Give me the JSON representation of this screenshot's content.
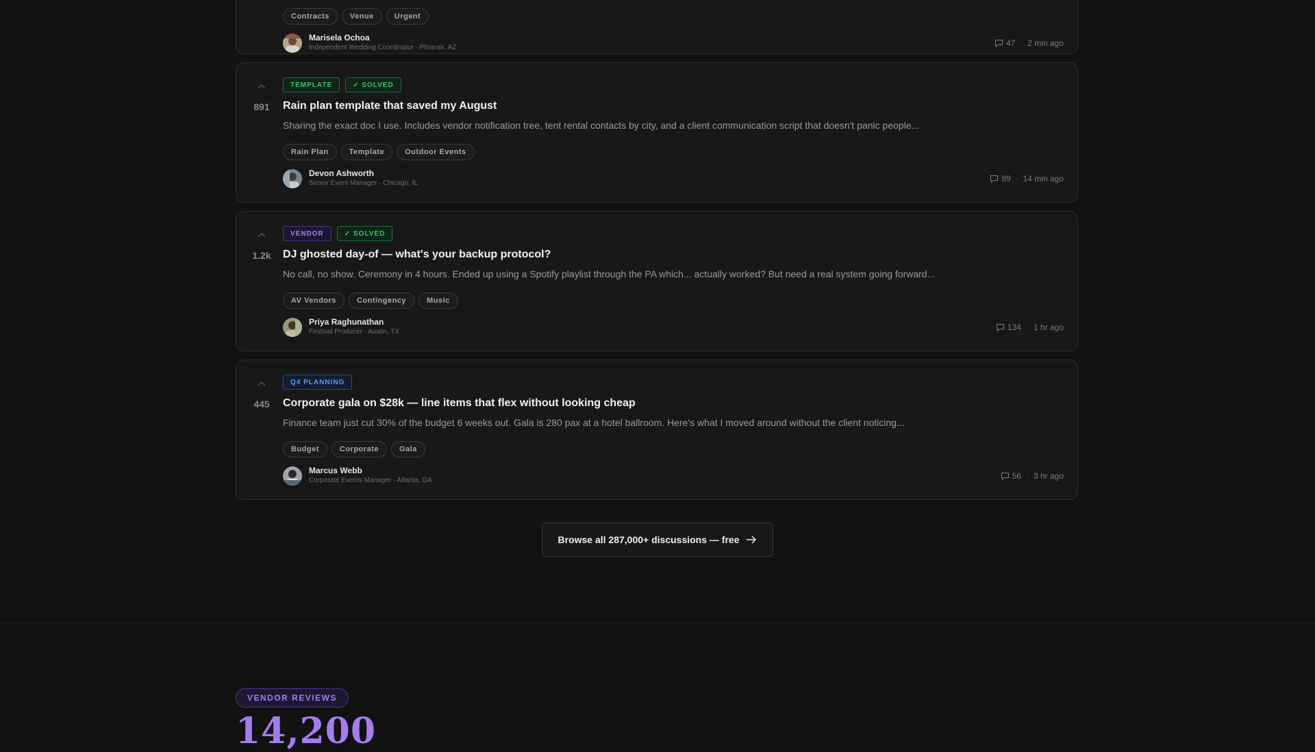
{
  "posts": [
    {
      "tags": [
        "Contracts",
        "Venue",
        "Urgent"
      ],
      "author": {
        "name": "Marisela Ochoa",
        "role": "Independent Wedding Coordinator · Phoenix, AZ"
      },
      "comments": "47",
      "time": "2 min ago"
    },
    {
      "votes": "891",
      "category": "TEMPLATE",
      "solved": "✓ SOLVED",
      "title": "Rain plan template that saved my August",
      "excerpt": "Sharing the exact doc I use. Includes vendor notification tree, tent rental contacts by city, and a client communication script that doesn't panic people...",
      "tags": [
        "Rain Plan",
        "Template",
        "Outdoor Events"
      ],
      "author": {
        "name": "Devon Ashworth",
        "role": "Senior Event Manager · Chicago, IL"
      },
      "comments": "89",
      "time": "14 min ago"
    },
    {
      "votes": "1.2k",
      "category": "VENDOR",
      "solved": "✓ SOLVED",
      "title": "DJ ghosted day-of — what's your backup protocol?",
      "excerpt": "No call, no show. Ceremony in 4 hours. Ended up using a Spotify playlist through the PA which... actually worked? But need a real system going forward...",
      "tags": [
        "AV Vendors",
        "Contingency",
        "Music"
      ],
      "author": {
        "name": "Priya Raghunathan",
        "role": "Festival Producer · Austin, TX"
      },
      "comments": "134",
      "time": "1 hr ago"
    },
    {
      "votes": "445",
      "category": "Q4 PLANNING",
      "title": "Corporate gala on $28k — line items that flex without looking cheap",
      "excerpt": "Finance team just cut 30% of the budget 6 weeks out. Gala is 280 pax at a hotel ballroom. Here's what I moved around without the client noticing...",
      "tags": [
        "Budget",
        "Corporate",
        "Gala"
      ],
      "author": {
        "name": "Marcus Webb",
        "role": "Corporate Events Manager · Atlanta, GA"
      },
      "comments": "56",
      "time": "3 hr ago"
    }
  ],
  "cta": {
    "label": "Browse all 287,000+ discussions — free"
  },
  "section": {
    "badge": "VENDOR REVIEWS",
    "big_number": "14,200"
  },
  "colors": {
    "accent_purple": "#a47cf0",
    "accent_green": "#3ec46d",
    "accent_blue": "#5a9df2",
    "background": "#121212"
  },
  "icons": {
    "upvote": "chevron-up-icon",
    "comments": "comment-bubble-icon",
    "arrow": "arrow-right-icon"
  }
}
